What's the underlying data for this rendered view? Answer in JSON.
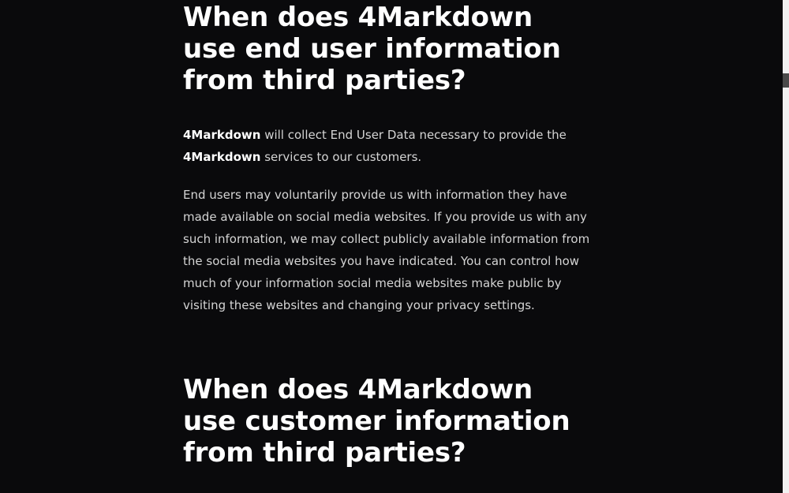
{
  "section1": {
    "heading": "When does 4Markdown use end user information from third parties?",
    "para1": {
      "brand1": "4Markdown",
      "text1": " will collect End User Data necessary to provide the ",
      "brand2": "4Markdown",
      "text2": " services to our customers."
    },
    "para2": "End users may voluntarily provide us with information they have made available on social media websites. If you provide us with any such information, we may collect publicly available information from the social media websites you have indicated. You can control how much of your information social media websites make public by visiting these websites and changing your privacy settings."
  },
  "section2": {
    "heading": "When does 4Markdown use customer information from third parties?"
  }
}
